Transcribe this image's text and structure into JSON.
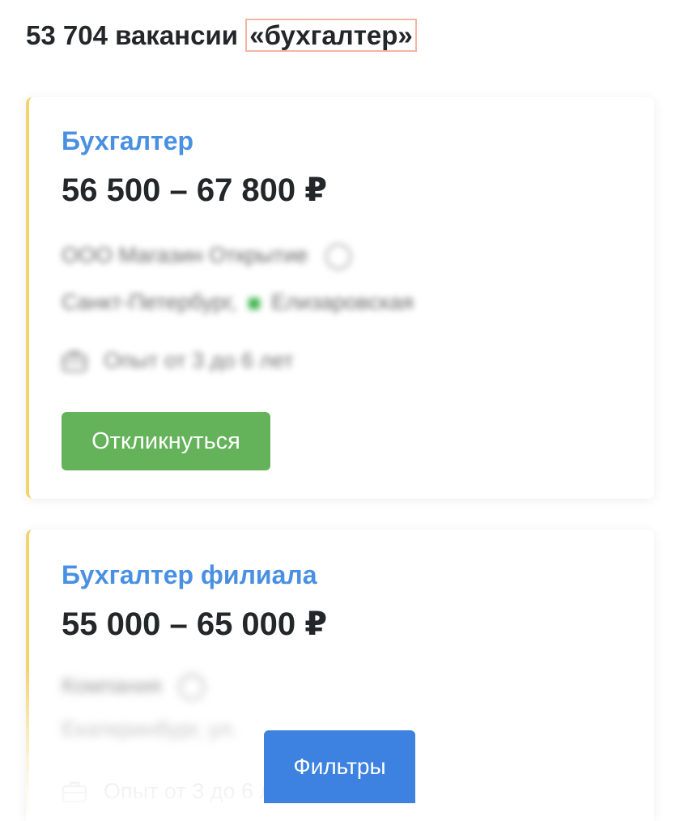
{
  "results": {
    "count_text": "53 704 вакансии",
    "query": "«бухгалтер»"
  },
  "vacancies": [
    {
      "title": "Бухгалтер",
      "salary": "56 500 – 67 800 ₽",
      "company": "ООО Магазин Открытие",
      "city": "Санкт-Петербург,",
      "metro": "Елизаровская",
      "experience": "Опыт от 3 до 6 лет",
      "respond_label": "Откликнуться"
    },
    {
      "title": "Бухгалтер филиала",
      "salary": "55 000 – 65 000 ₽",
      "company": "Компания",
      "city": "Екатеринбург, ул.",
      "experience": "Опыт от 3 до 6 лет"
    }
  ],
  "filters_label": "Фильтры",
  "colors": {
    "accent_blue": "#4a90e2",
    "respond_green": "#64b35a",
    "filters_blue": "#3d82e0",
    "card_stripe": "#f3d36b",
    "query_border": "#f4b4a4"
  }
}
